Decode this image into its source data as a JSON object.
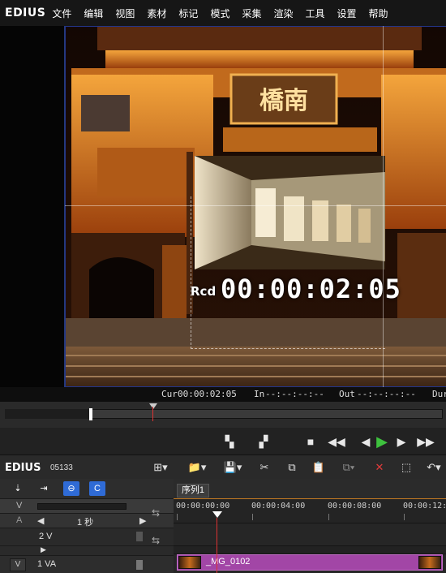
{
  "app": {
    "name": "EDIUS"
  },
  "menu": [
    "文件",
    "编辑",
    "视图",
    "素材",
    "标记",
    "模式",
    "采集",
    "渲染",
    "工具",
    "设置",
    "帮助"
  ],
  "preview": {
    "sign_text": "橋南",
    "rec_label": "Rcd",
    "rec_timecode": "00:00:02:05"
  },
  "info_bar": {
    "cur_label": "Cur",
    "cur_value": "00:00:02:05",
    "in_label": "In",
    "in_value": "--:--:--:--",
    "out_label": "Out",
    "out_value": "--:--:--:--",
    "dur_label": "Dur"
  },
  "timeline": {
    "logo": "EDIUS",
    "project_name": "05133",
    "sequence_tab": "序列1",
    "scale_value": "1 秒",
    "track_header_v": "V",
    "track_header_a": "A",
    "tracks": [
      {
        "id": "2 V"
      },
      {
        "side": "V",
        "id": "1 VA"
      }
    ],
    "ruler_labels": [
      "00:00:00:00",
      "00:00:04:00",
      "00:00:08:00",
      "00:00:12:0"
    ],
    "clip": {
      "name": "_MG_0102",
      "color": "#a246a6"
    },
    "playhead_seconds": 2.2
  }
}
